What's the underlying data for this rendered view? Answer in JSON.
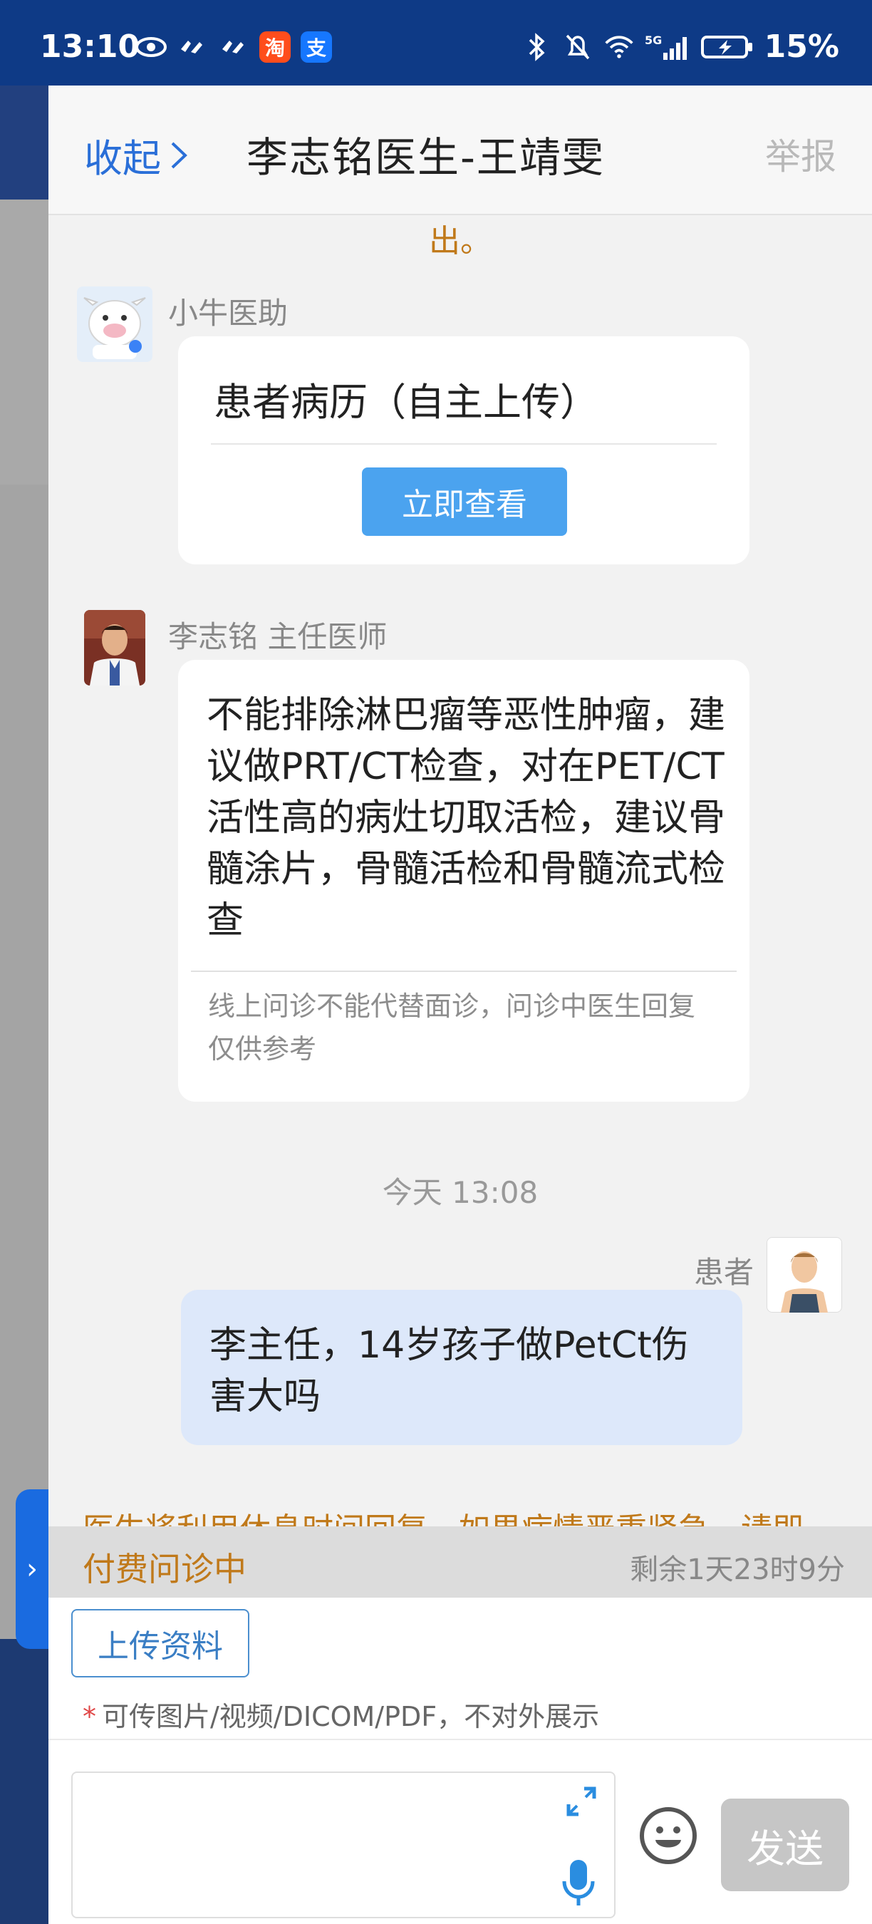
{
  "status_bar": {
    "time": "13:10",
    "battery": "15%",
    "network": "5G",
    "app_badges": [
      {
        "text": "淘",
        "color": "#ff4d1c"
      },
      {
        "text": "支",
        "color": "#1677ff"
      }
    ]
  },
  "header": {
    "collapse_label": "收起",
    "title": "李志铭医生-王靖雯",
    "report_label": "举报"
  },
  "chat": {
    "previous_tail": "出。",
    "messages": [
      {
        "sender": "小牛医助",
        "card_title": "患者病历（自主上传）",
        "button_label": "立即查看"
      },
      {
        "sender": "李志铭 主任医师",
        "text": "不能排除淋巴瘤等恶性肿瘤，建议做PRT/CT检查，对在PET/CT活性高的病灶切取活检，建议骨髓涂片，骨髓活检和骨髓流式检查",
        "note": "线上问诊不能代替面诊，问诊中医生回复仅供参考"
      },
      {
        "sender": "患者",
        "text": "李主任，14岁孩子做PetCt伤害大吗"
      }
    ],
    "time_separator": "今天 13:08",
    "notice": "医生将利用休息时间回复，如果病情严重紧急，请即"
  },
  "consult": {
    "status_label": "付费问诊中",
    "remaining": "剩余1天23时9分"
  },
  "upload": {
    "button_label": "上传资料",
    "hint_star": "*",
    "hint": "可传图片/视频/DICOM/PDF，不对外展示"
  },
  "composer": {
    "placeholder": "",
    "send_label": "发送"
  },
  "colors": {
    "accent": "#2a6fd8",
    "status_bar": "#0e3a86",
    "warning": "#c0791a",
    "view_button": "#4ba3ef",
    "patient_bubble": "#dde8fa"
  }
}
